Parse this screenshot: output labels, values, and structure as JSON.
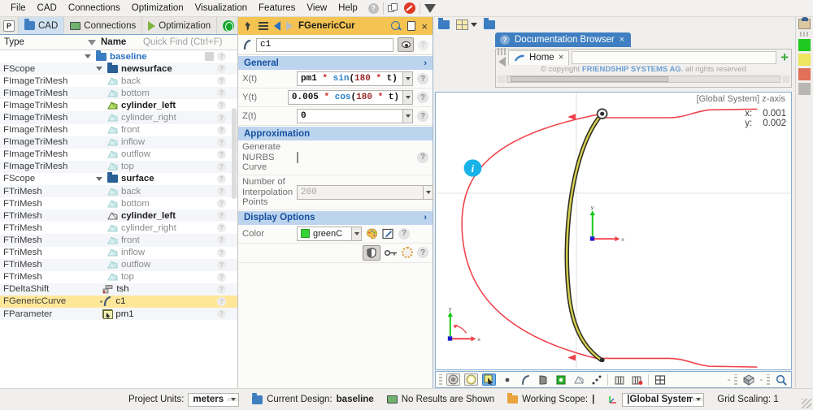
{
  "menubar": {
    "items": [
      "File",
      "CAD",
      "Connections",
      "Optimization",
      "Visualization",
      "Features",
      "View",
      "Help"
    ],
    "icons": [
      "help-icon",
      "copy-icon",
      "forbidden-icon",
      "funnel-icon"
    ]
  },
  "tree_panel": {
    "tabs": [
      {
        "label": "P",
        "icon": "p-box-icon",
        "active": false
      },
      {
        "label": "CAD",
        "icon": "folder-icon",
        "active": true
      },
      {
        "label": "Connections",
        "icon": "monitor-icon",
        "active": false
      },
      {
        "label": "Optimization",
        "icon": "play-icon",
        "active": false
      },
      {
        "label": "",
        "icon": "globe-icon",
        "active": false
      }
    ],
    "header": {
      "type": "Type",
      "name": "Name",
      "find_placeholder": "Quick Find (Ctrl+F)"
    },
    "rows": [
      {
        "type": "",
        "name": "baseline",
        "indent": 0,
        "icon": "folder-icon",
        "style": "blue",
        "arrow": true,
        "selected": false
      },
      {
        "type": "FScope",
        "name": "newsurface",
        "indent": 1,
        "icon": "folder-dark-icon",
        "style": "bold",
        "arrow": true,
        "selected": false
      },
      {
        "type": "FImageTriMesh",
        "name": "back",
        "indent": 2,
        "icon": "mesh-icon-dim",
        "style": "dim",
        "arrow": false,
        "selected": false
      },
      {
        "type": "FImageTriMesh",
        "name": "bottom",
        "indent": 2,
        "icon": "mesh-icon-dim",
        "style": "dim",
        "arrow": false,
        "selected": false
      },
      {
        "type": "FImageTriMesh",
        "name": "cylinder_left",
        "indent": 2,
        "icon": "mesh-icon-green",
        "style": "bold",
        "arrow": false,
        "selected": false
      },
      {
        "type": "FImageTriMesh",
        "name": "cylinder_right",
        "indent": 2,
        "icon": "mesh-icon-dim",
        "style": "dim",
        "arrow": false,
        "selected": false
      },
      {
        "type": "FImageTriMesh",
        "name": "front",
        "indent": 2,
        "icon": "mesh-icon-dim",
        "style": "dim",
        "arrow": false,
        "selected": false
      },
      {
        "type": "FImageTriMesh",
        "name": "inflow",
        "indent": 2,
        "icon": "mesh-icon-dim",
        "style": "dim",
        "arrow": false,
        "selected": false
      },
      {
        "type": "FImageTriMesh",
        "name": "outflow",
        "indent": 2,
        "icon": "mesh-icon-dim",
        "style": "dim",
        "arrow": false,
        "selected": false
      },
      {
        "type": "FImageTriMesh",
        "name": "top",
        "indent": 2,
        "icon": "mesh-icon-dim",
        "style": "dim",
        "arrow": false,
        "selected": false
      },
      {
        "type": "FScope",
        "name": "surface",
        "indent": 1,
        "icon": "folder-dark-icon",
        "style": "bold",
        "arrow": true,
        "selected": false
      },
      {
        "type": "FTriMesh",
        "name": "back",
        "indent": 2,
        "icon": "mesh-icon-dim",
        "style": "dim",
        "arrow": false,
        "selected": false
      },
      {
        "type": "FTriMesh",
        "name": "bottom",
        "indent": 2,
        "icon": "mesh-icon-dim",
        "style": "dim",
        "arrow": false,
        "selected": false
      },
      {
        "type": "FTriMesh",
        "name": "cylinder_left",
        "indent": 2,
        "icon": "mesh-icon-grey",
        "style": "bold",
        "arrow": false,
        "selected": false
      },
      {
        "type": "FTriMesh",
        "name": "cylinder_right",
        "indent": 2,
        "icon": "mesh-icon-dim",
        "style": "dim",
        "arrow": false,
        "selected": false
      },
      {
        "type": "FTriMesh",
        "name": "front",
        "indent": 2,
        "icon": "mesh-icon-dim",
        "style": "dim",
        "arrow": false,
        "selected": false
      },
      {
        "type": "FTriMesh",
        "name": "inflow",
        "indent": 2,
        "icon": "mesh-icon-dim",
        "style": "dim",
        "arrow": false,
        "selected": false
      },
      {
        "type": "FTriMesh",
        "name": "outflow",
        "indent": 2,
        "icon": "mesh-icon-dim",
        "style": "dim",
        "arrow": false,
        "selected": false
      },
      {
        "type": "FTriMesh",
        "name": "top",
        "indent": 2,
        "icon": "mesh-icon-dim",
        "style": "dim",
        "arrow": false,
        "selected": false
      },
      {
        "type": "FDeltaShift",
        "name": "tsh",
        "indent": 1.6,
        "icon": "shift-icon",
        "style": "normal",
        "arrow": false,
        "selected": false
      },
      {
        "type": "FGenericCurve",
        "name": "c1",
        "indent": 1.6,
        "icon": "curve-icon",
        "style": "normal",
        "arrow": false,
        "selected": true
      },
      {
        "type": "FParameter",
        "name": "pm1",
        "indent": 1.6,
        "icon": "param-icon",
        "style": "normal",
        "arrow": false,
        "selected": false
      }
    ]
  },
  "properties": {
    "title": "FGenericCur",
    "title_icons": [
      "pin-icon",
      "menu-icon",
      "nav-back-icon",
      "nav-forward-icon",
      "search-icon",
      "copy-icon",
      "close-icon"
    ],
    "name_value": "c1",
    "sections": {
      "general": {
        "title": "General",
        "fields": [
          {
            "label": "X(t)",
            "value": "pm1 * sin(180 * t)",
            "parts": [
              {
                "t": "pm1",
                "c": "pl"
              },
              {
                "t": " * ",
                "c": "op"
              },
              {
                "t": "sin",
                "c": "fn"
              },
              {
                "t": "(",
                "c": "pl"
              },
              {
                "t": "180",
                "c": "num"
              },
              {
                "t": " * ",
                "c": "op"
              },
              {
                "t": "t",
                "c": "pl"
              },
              {
                "t": ")",
                "c": "pl"
              }
            ]
          },
          {
            "label": "Y(t)",
            "value": "0.005 * cos(180 * t)",
            "parts": [
              {
                "t": "0.005",
                "c": "pl"
              },
              {
                "t": " * ",
                "c": "op"
              },
              {
                "t": "cos",
                "c": "fn"
              },
              {
                "t": "(",
                "c": "pl"
              },
              {
                "t": "180",
                "c": "num"
              },
              {
                "t": " * ",
                "c": "op"
              },
              {
                "t": "t",
                "c": "pl"
              },
              {
                "t": ")",
                "c": "pl"
              }
            ]
          },
          {
            "label": "Z(t)",
            "value": "0",
            "parts": [
              {
                "t": "0",
                "c": "pl"
              }
            ]
          }
        ]
      },
      "approximation": {
        "title": "Approximation",
        "nurbs_label": "Generate NURBS Curve",
        "nurbs_checked": false,
        "points_label": "Number of Interpolation Points",
        "points_value": "200"
      },
      "display": {
        "title": "Display Options",
        "color_label": "Color",
        "color_value": "greenC",
        "color_hex": "#35d335",
        "icons": [
          "palette-icon",
          "pen-icon",
          "shield-icon",
          "key-icon",
          "dashed-circle-icon"
        ]
      }
    }
  },
  "doc_browser": {
    "tab_label": "Documentation Browser",
    "inner_tab_label": "Home",
    "copyright_prefix": "© copyright ",
    "copyright_company": "FRIENDSHIP SYSTEMS AG",
    "copyright_suffix": ", all rights reserved"
  },
  "viewport": {
    "system_label": "[Global System] z-axis",
    "coord_x_key": "x:",
    "coord_x_value": "0.001",
    "coord_y_key": "y:",
    "coord_y_value": "0.002",
    "axis_x_label": "x",
    "axis_y_label": "y",
    "info_badge": "i",
    "toolbar_icons": [
      "sphere-shaded-icon",
      "sphere-outline-icon",
      "cursor-select-icon",
      "point-icon",
      "curve-icon",
      "surface-icon",
      "solid-icon",
      "mesh-icon",
      "dots-icon",
      "section-icon",
      "section-red-icon",
      "grid-icon",
      "cube-icon",
      "zoom-icon"
    ]
  },
  "edge_toolbar": {
    "swatches": [
      "#1fc91f",
      "#ede45f",
      "#e0705a",
      "#b9b7b3"
    ]
  },
  "status_bar": {
    "project_units_label": "Project Units:",
    "project_units_value": "meters",
    "current_design_label": "Current Design:",
    "current_design_value": "baseline",
    "results_text": "No Results are Shown",
    "working_scope_label": "Working Scope:",
    "working_scope_value": "|",
    "system_value": "|Global System",
    "grid_scaling_label": "Grid Scaling: 1"
  }
}
